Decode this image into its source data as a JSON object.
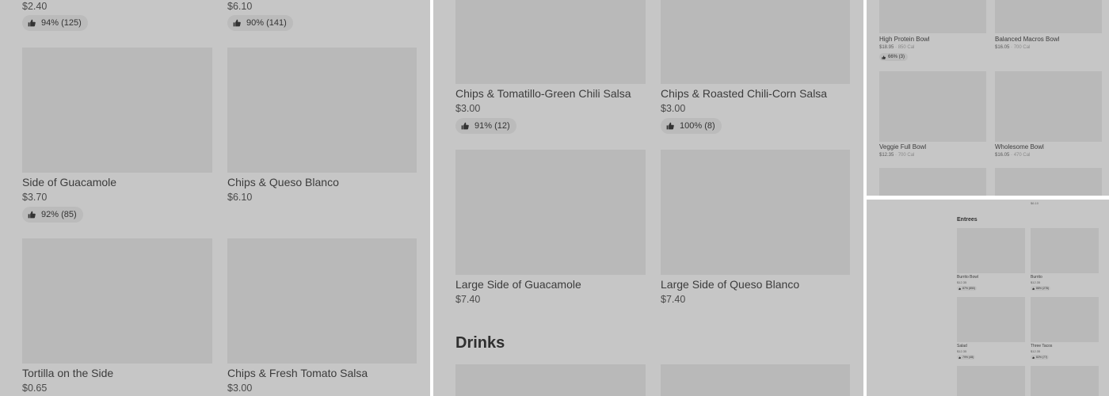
{
  "panel1": {
    "top_prices": [
      "$2.40",
      "$6.10"
    ],
    "top_badges": [
      "94% (125)",
      "90% (141)"
    ],
    "items": [
      {
        "name": "Side of Guacamole",
        "price": "$3.70",
        "badge": "92% (85)"
      },
      {
        "name": "Chips & Queso Blanco",
        "price": "$6.10"
      },
      {
        "name": "Tortilla on the Side",
        "price": "$0.65"
      },
      {
        "name": "Chips & Fresh Tomato Salsa",
        "price": "$3.00"
      }
    ]
  },
  "panel2": {
    "items": [
      {
        "name": "Chips & Tomatillo-Green Chili Salsa",
        "price": "$3.00",
        "badge": "91% (12)"
      },
      {
        "name": "Chips & Roasted Chili-Corn Salsa",
        "price": "$3.00",
        "badge": "100% (8)"
      },
      {
        "name": "Large Side of Guacamole",
        "price": "$7.40"
      },
      {
        "name": "Large Side of Queso Blanco",
        "price": "$7.40"
      }
    ],
    "section_heading": "Drinks"
  },
  "panel3": {
    "items": [
      {
        "name": "High Protein Bowl",
        "price": "$18.95",
        "cal": "850 Cal",
        "badge": "66% (3)"
      },
      {
        "name": "Balanced Macros Bowl",
        "price": "$16.05",
        "cal": "700 Cal"
      },
      {
        "name": "Veggie Full Bowl",
        "price": "$12.35",
        "cal": "700 Cal"
      },
      {
        "name": "Wholesome Bowl",
        "price": "$16.05",
        "cal": "470 Cal"
      }
    ],
    "separator": " · "
  },
  "panel4": {
    "top_fragment": "$6.10",
    "section_heading": "Entrees",
    "items": [
      {
        "name": "Burrito Bowl",
        "price": "$12.35",
        "badge": "87% (850)"
      },
      {
        "name": "Burrito",
        "price": "$12.35",
        "badge": "88% (278)"
      },
      {
        "name": "Salad",
        "price": "$12.35",
        "badge": "79% (48)"
      },
      {
        "name": "Three Tacos",
        "price": "$12.35",
        "badge": "82% (77)"
      }
    ]
  },
  "icons": {
    "thumb": "thumbs-up-icon"
  }
}
